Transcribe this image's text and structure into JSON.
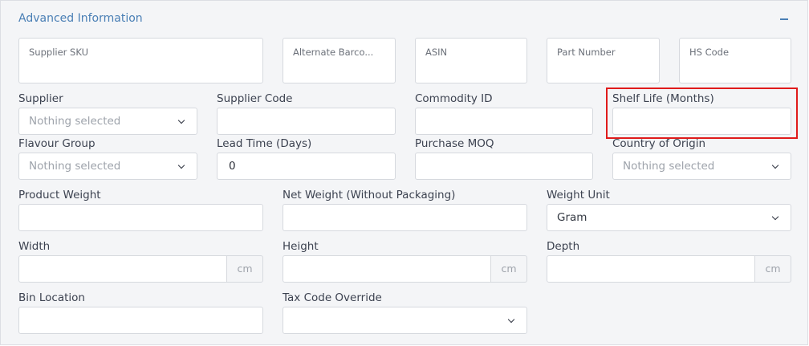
{
  "section": {
    "title": "Advanced Information",
    "collapse_icon": "minus-icon"
  },
  "top_fields": [
    {
      "placeholder": "Supplier SKU"
    },
    {
      "placeholder": "Alternate Barco..."
    },
    {
      "placeholder": "ASIN"
    },
    {
      "placeholder": "Part Number"
    },
    {
      "placeholder": "HS Code"
    }
  ],
  "row1": {
    "supplier": {
      "label": "Supplier",
      "value": "Nothing selected"
    },
    "supplier_code": {
      "label": "Supplier Code",
      "value": ""
    },
    "commodity_id": {
      "label": "Commodity ID",
      "value": ""
    },
    "shelf_life": {
      "label": "Shelf Life (Months)",
      "value": ""
    }
  },
  "row2": {
    "flavour_group": {
      "label": "Flavour Group",
      "value": "Nothing selected"
    },
    "lead_time": {
      "label": "Lead Time (Days)",
      "value": "0"
    },
    "purchase_moq": {
      "label": "Purchase MOQ",
      "value": ""
    },
    "country_of_origin": {
      "label": "Country of Origin",
      "value": "Nothing selected"
    }
  },
  "row3": {
    "product_weight": {
      "label": "Product Weight",
      "value": ""
    },
    "net_weight": {
      "label": "Net Weight (Without Packaging)",
      "value": ""
    },
    "weight_unit": {
      "label": "Weight Unit",
      "value": "Gram"
    }
  },
  "row4": {
    "width": {
      "label": "Width",
      "value": "",
      "unit": "cm"
    },
    "height": {
      "label": "Height",
      "value": "",
      "unit": "cm"
    },
    "depth": {
      "label": "Depth",
      "value": "",
      "unit": "cm"
    }
  },
  "row5": {
    "bin_location": {
      "label": "Bin Location",
      "value": ""
    },
    "tax_code_override": {
      "label": "Tax Code Override",
      "value": ""
    }
  },
  "colors": {
    "accent": "#4a7fb5",
    "highlight": "#e01b1b"
  }
}
